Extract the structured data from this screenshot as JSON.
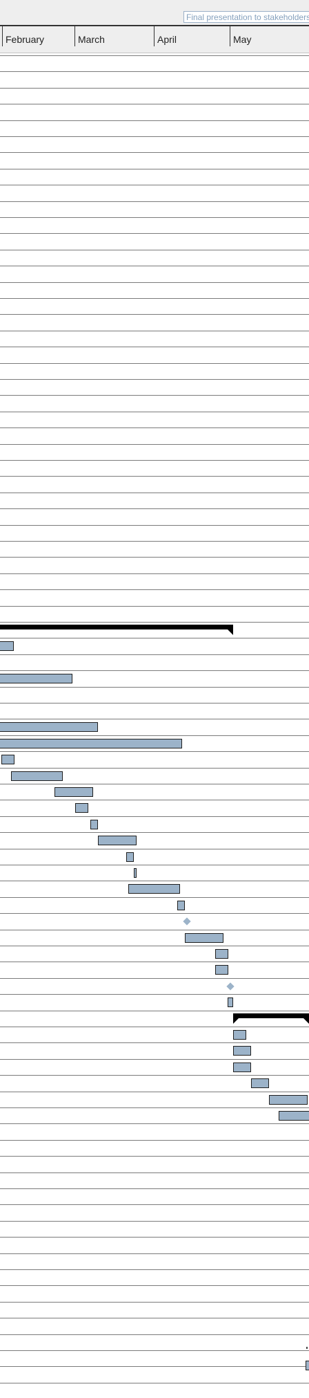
{
  "timescale": {
    "months": [
      "February",
      "March",
      "April",
      "May"
    ]
  },
  "callout": {
    "text": "Final presentation to stakeholders"
  },
  "gantt": {
    "row_count": 83,
    "colors": {
      "task_bar": "#9cb3c9",
      "task_border": "#1f1f1f",
      "summary": "#000000",
      "gridline": "#7b7b7b",
      "header_bg": "#eeeeee",
      "callout_text": "#86a1bd"
    }
  }
}
